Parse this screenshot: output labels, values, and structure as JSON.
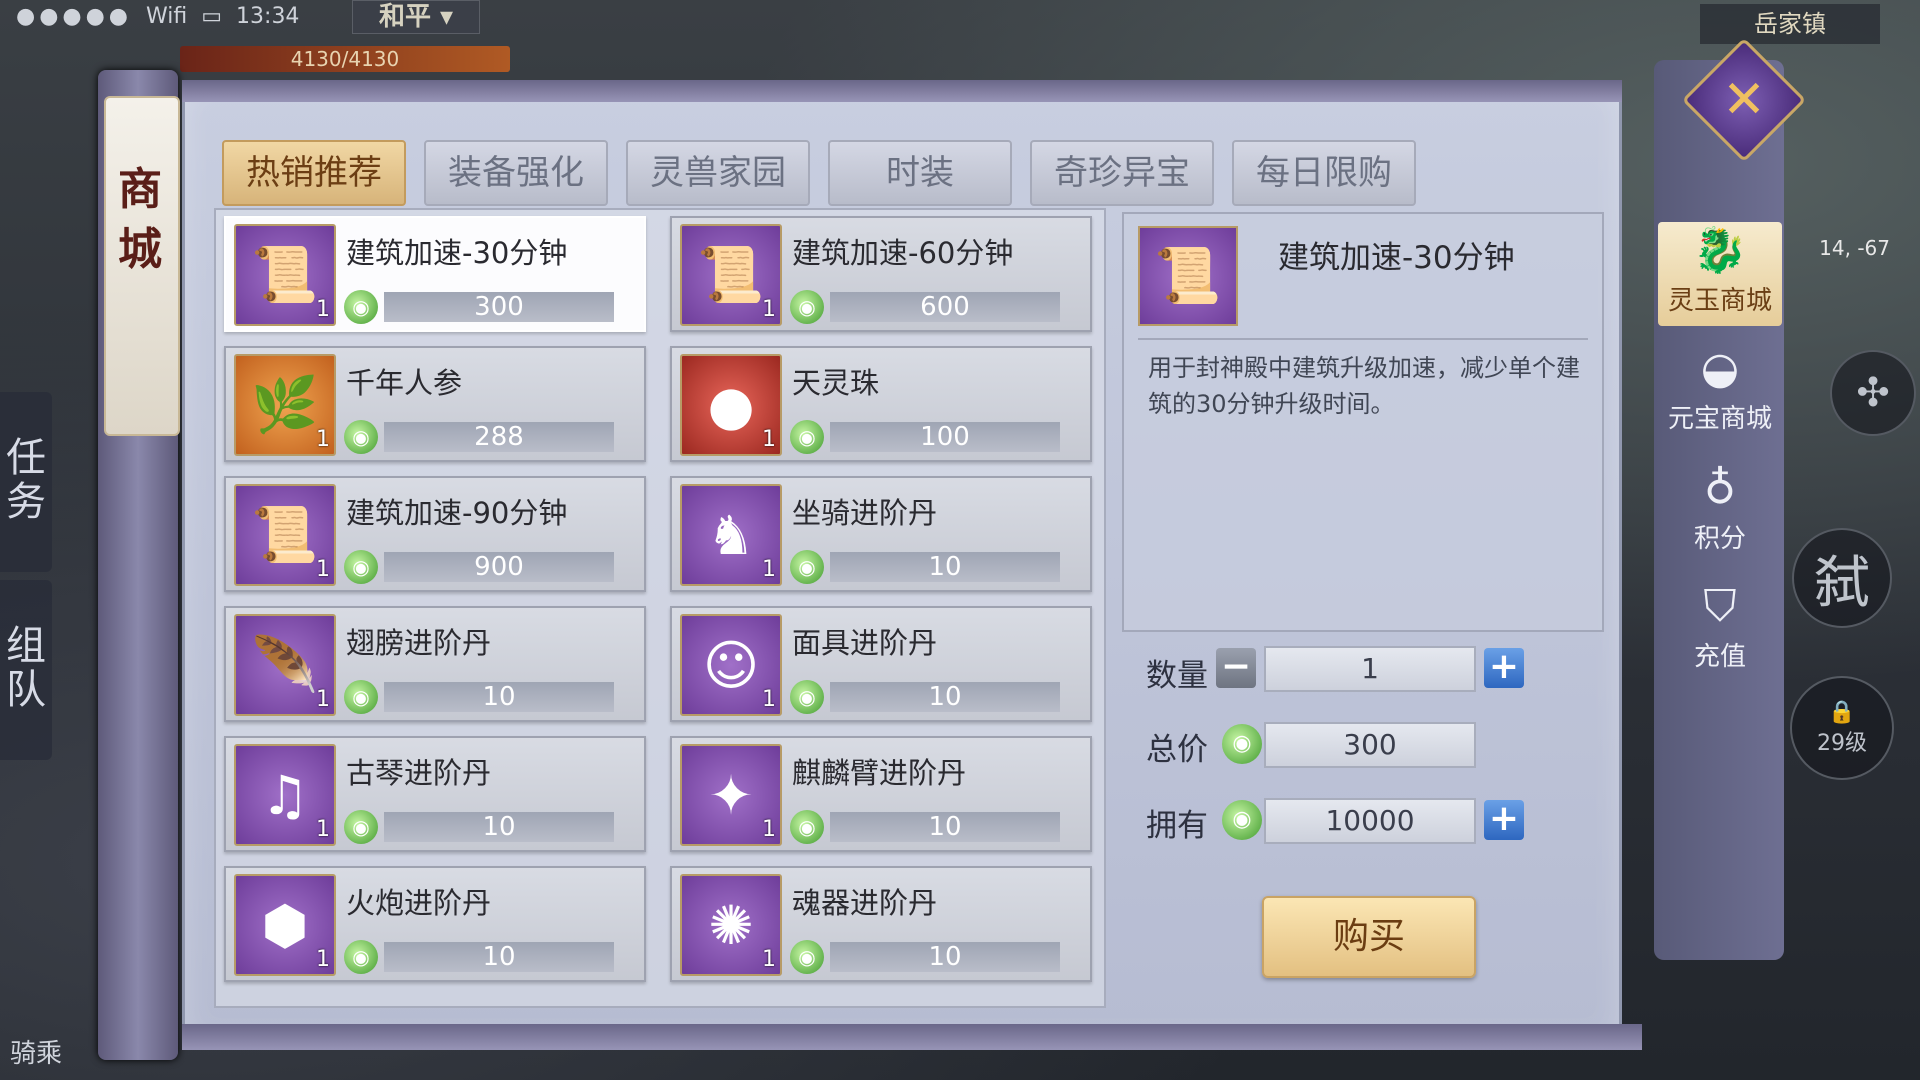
{
  "status": {
    "network": "Wifi",
    "time": "13:34",
    "mode": "和平",
    "hp": "4130/4130",
    "location": "岳家镇",
    "coords": "14, -67"
  },
  "side": {
    "task": "任务",
    "team": "组队",
    "mount": "骑乘",
    "level_lock": "29级",
    "kill": "弑"
  },
  "shop": {
    "title": "商城"
  },
  "tabs": [
    "热销推荐",
    "装备强化",
    "灵兽家园",
    "时装",
    "奇珍异宝",
    "每日限购"
  ],
  "items": [
    {
      "name": "建筑加速-30分钟",
      "price": "300",
      "count": "1"
    },
    {
      "name": "建筑加速-60分钟",
      "price": "600",
      "count": "1"
    },
    {
      "name": "千年人参",
      "price": "288",
      "count": "1"
    },
    {
      "name": "天灵珠",
      "price": "100",
      "count": "1"
    },
    {
      "name": "建筑加速-90分钟",
      "price": "900",
      "count": "1"
    },
    {
      "name": "坐骑进阶丹",
      "price": "10",
      "count": "1"
    },
    {
      "name": "翅膀进阶丹",
      "price": "10",
      "count": "1"
    },
    {
      "name": "面具进阶丹",
      "price": "10",
      "count": "1"
    },
    {
      "name": "古琴进阶丹",
      "price": "10",
      "count": "1"
    },
    {
      "name": "麒麟臂进阶丹",
      "price": "10",
      "count": "1"
    },
    {
      "name": "火炮进阶丹",
      "price": "10",
      "count": "1"
    },
    {
      "name": "魂器进阶丹",
      "price": "10",
      "count": "1"
    }
  ],
  "detail": {
    "name": "建筑加速-30分钟",
    "desc": "用于封神殿中建筑升级加速，减少单个建筑的30分钟升级时间。",
    "qty_label": "数量",
    "qty": "1",
    "total_label": "总价",
    "total": "300",
    "own_label": "拥有",
    "own": "10000",
    "buy": "购买"
  },
  "nav": [
    "灵玉商城",
    "元宝商城",
    "积分",
    "充值"
  ],
  "icons": {
    "close": "close-x-icon",
    "jade": "jade-currency-icon"
  }
}
